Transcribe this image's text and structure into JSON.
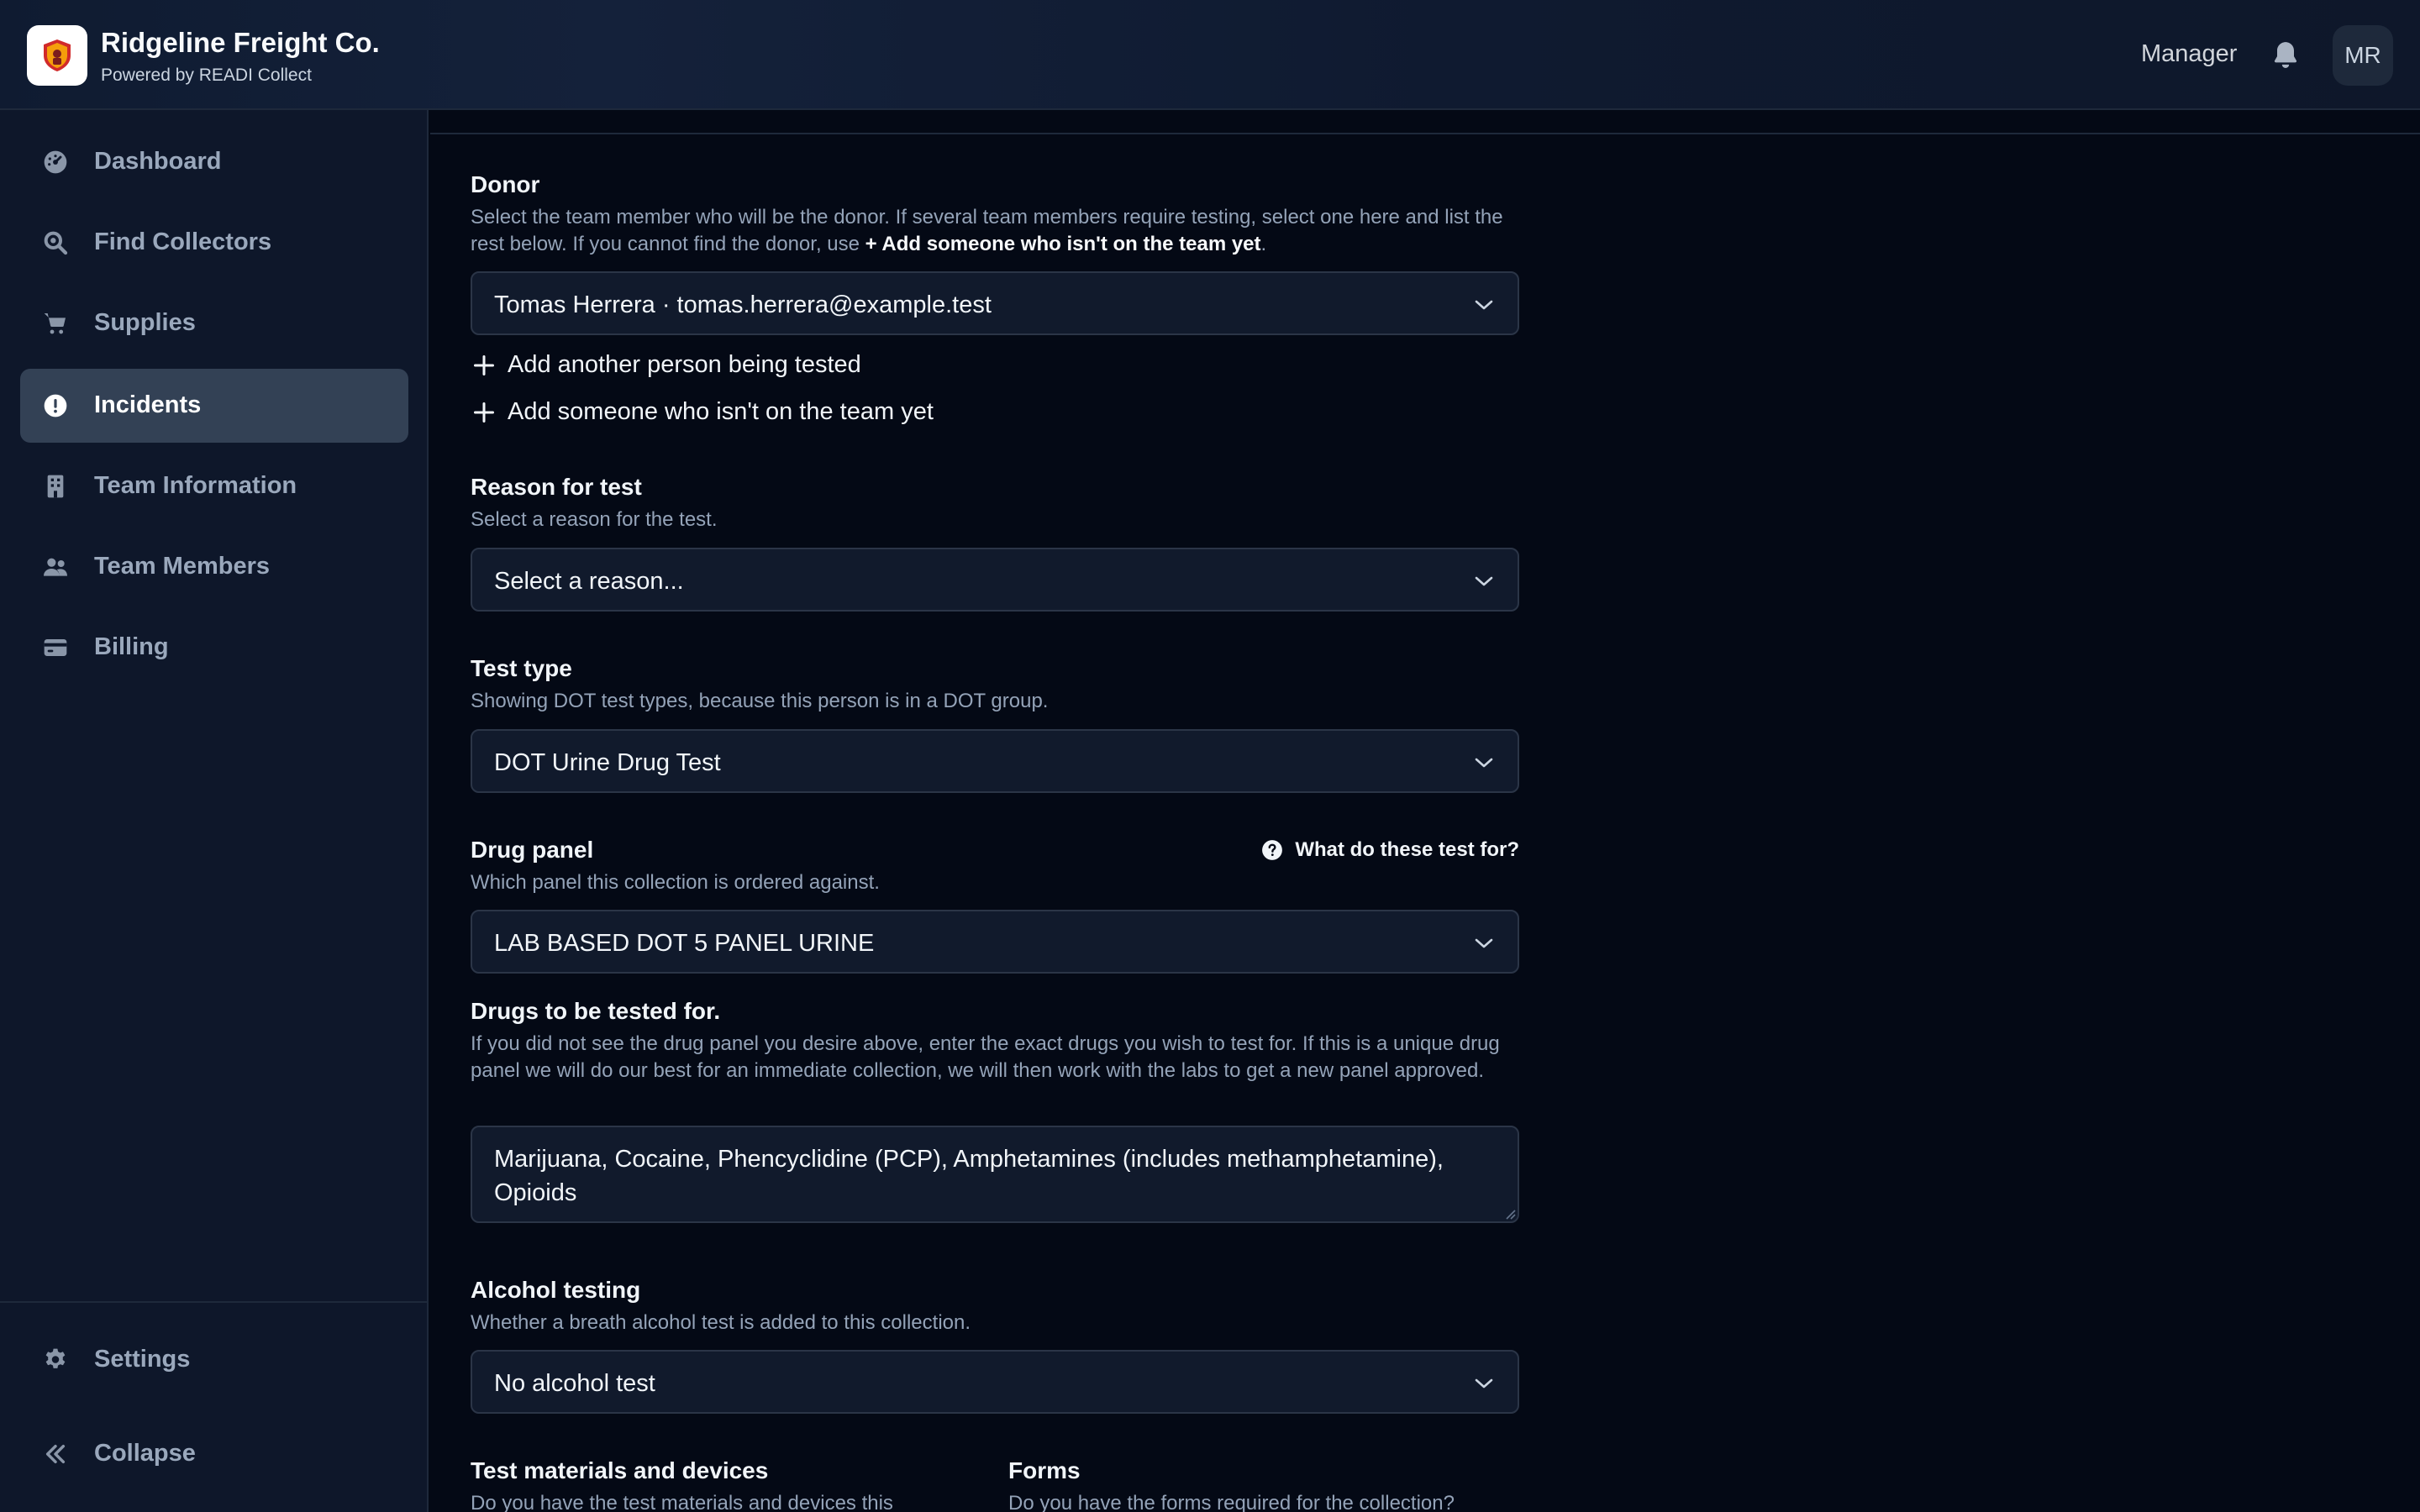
{
  "header": {
    "company": "Ridgeline Freight Co.",
    "powered_by": "Powered by READI Collect",
    "role": "Manager",
    "avatar_initials": "MR"
  },
  "sidebar": {
    "items": [
      {
        "label": "Dashboard",
        "icon": "dashboard-icon"
      },
      {
        "label": "Find Collectors",
        "icon": "search-icon"
      },
      {
        "label": "Supplies",
        "icon": "cart-icon"
      },
      {
        "label": "Incidents",
        "icon": "alert-icon",
        "active": true
      },
      {
        "label": "Team Information",
        "icon": "building-icon"
      },
      {
        "label": "Team Members",
        "icon": "users-icon"
      },
      {
        "label": "Billing",
        "icon": "credit-card-icon"
      }
    ],
    "settings_label": "Settings",
    "collapse_label": "Collapse"
  },
  "form": {
    "donor": {
      "title": "Donor",
      "desc_before": "Select the team member who will be the donor. If several team members require testing, select one here and list the rest below. If you cannot find the donor, use ",
      "desc_bold": "+ Add someone who isn't on the team yet",
      "desc_after": ".",
      "value": "Tomas Herrera · tomas.herrera@example.test",
      "add_another": "Add another person being tested",
      "add_new": "Add someone who isn't on the team yet"
    },
    "reason": {
      "title": "Reason for test",
      "desc": "Select a reason for the test.",
      "value": "Select a reason..."
    },
    "test_type": {
      "title": "Test type",
      "desc": "Showing DOT test types, because this person is in a DOT group.",
      "value": "DOT Urine Drug Test"
    },
    "drug_panel": {
      "title": "Drug panel",
      "help": "What do these test for?",
      "desc": "Which panel this collection is ordered against.",
      "value": "LAB BASED DOT 5 PANEL URINE"
    },
    "drugs": {
      "title": "Drugs to be tested for.",
      "desc": "If you did not see the drug panel you desire above, enter the exact drugs you wish to test for. If this is a unique drug panel we will do our best for an immediate collection, we will then work with the labs to get a new panel approved.",
      "value": "Marijuana, Cocaine, Phencyclidine (PCP), Amphetamines (includes methamphetamine), Opioids"
    },
    "alcohol": {
      "title": "Alcohol testing",
      "desc": "Whether a breath alcohol test is added to this collection.",
      "value": "No alcohol test"
    },
    "materials": {
      "title": "Test materials and devices",
      "desc": "Do you have the test materials and devices this"
    },
    "forms": {
      "title": "Forms",
      "desc": "Do you have the forms required for the collection?"
    }
  },
  "colors": {
    "background": "#040915",
    "sidebar": "#0e172a",
    "active_item": "#334155",
    "input_bg": "#111a2c",
    "muted_text": "#94a3b8"
  }
}
